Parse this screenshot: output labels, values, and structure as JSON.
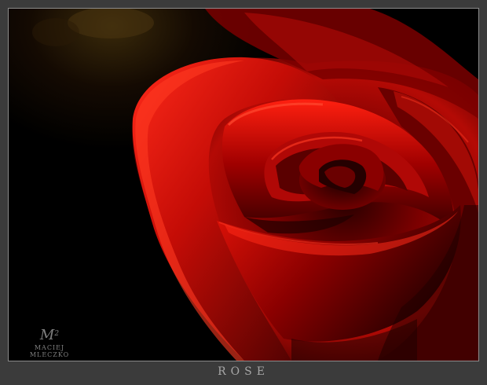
{
  "watermark": {
    "mark": "M",
    "superscript": "2",
    "author": "MACIEJ MLECZKO"
  },
  "caption": "ROSE",
  "colors": {
    "frame": "#3b3b3b",
    "border": "#8c8c8c",
    "rose_dark": "#3a0000",
    "rose_mid": "#a00000",
    "rose_bright": "#ff1a10",
    "caption_text": "#a7a7a7"
  },
  "photo": {
    "subject": "red rose close-up on dark background"
  }
}
